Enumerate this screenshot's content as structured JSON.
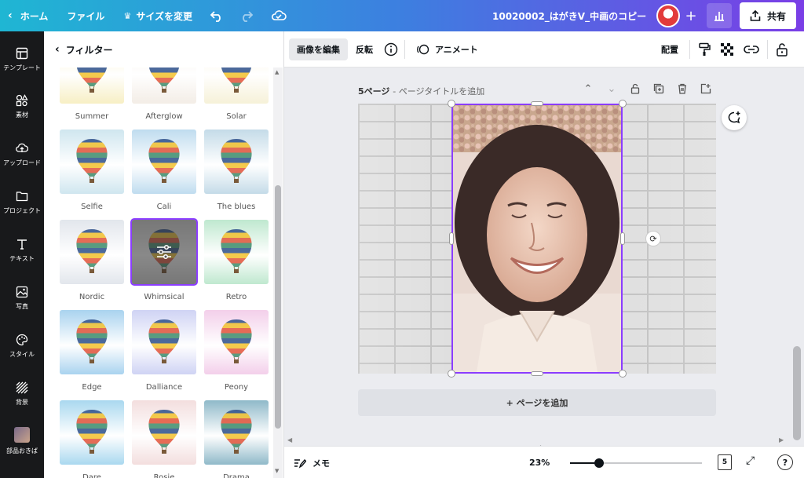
{
  "topbar": {
    "home_label": "ホーム",
    "file_label": "ファイル",
    "resize_label": "サイズを変更",
    "doc_title": "10020002_はがきV_中画のコピー",
    "share_label": "共有"
  },
  "rail": {
    "items": [
      {
        "label": "テンプレート",
        "icon": "template-icon"
      },
      {
        "label": "素材",
        "icon": "elements-icon"
      },
      {
        "label": "アップロード",
        "icon": "upload-icon"
      },
      {
        "label": "プロジェクト",
        "icon": "folder-icon"
      },
      {
        "label": "テキスト",
        "icon": "text-icon"
      },
      {
        "label": "写真",
        "icon": "photo-icon"
      },
      {
        "label": "スタイル",
        "icon": "palette-icon"
      },
      {
        "label": "背景",
        "icon": "background-icon"
      },
      {
        "label": "部品おきば",
        "icon": "thumbnail-icon"
      }
    ]
  },
  "panel": {
    "title": "フィルター",
    "filters": [
      {
        "name": "Summer",
        "tint": "#f7efc4"
      },
      {
        "name": "Afterglow",
        "tint": "#f3ede6"
      },
      {
        "name": "Solar",
        "tint": "#f6f1d8"
      },
      {
        "name": "Selfie",
        "tint": "#cfe6ef"
      },
      {
        "name": "Cali",
        "tint": "#bfdcef"
      },
      {
        "name": "The blues",
        "tint": "#c4dbe8"
      },
      {
        "name": "Nordic",
        "tint": "#e2e6ec"
      },
      {
        "name": "Whimsical",
        "tint": "#d8d8d8",
        "selected": true
      },
      {
        "name": "Retro",
        "tint": "#bfe8cf"
      },
      {
        "name": "Edge",
        "tint": "#a9d3ef"
      },
      {
        "name": "Dalliance",
        "tint": "#cfd3f4"
      },
      {
        "name": "Peony",
        "tint": "#f3cfea"
      },
      {
        "name": "Dare",
        "tint": "#a9d8ef"
      },
      {
        "name": "Rosie",
        "tint": "#f3dede"
      },
      {
        "name": "Drama",
        "tint": "#8fb9c9"
      }
    ]
  },
  "editbar": {
    "edit_image": "画像を編集",
    "flip": "反転",
    "animate": "アニメート",
    "position": "配置"
  },
  "canvas": {
    "page_label": "5ページ",
    "page_title_placeholder": "ページタイトルを追加",
    "add_page": "+ ページを追加"
  },
  "bottombar": {
    "memo": "メモ",
    "zoom": "23%",
    "zoom_fraction": 0.22,
    "page_count": "5"
  },
  "colors": {
    "accent": "#8b3dff",
    "rail_bg": "#18191b",
    "topbar_start": "#1fb6d3",
    "topbar_end": "#7a3ee6"
  }
}
